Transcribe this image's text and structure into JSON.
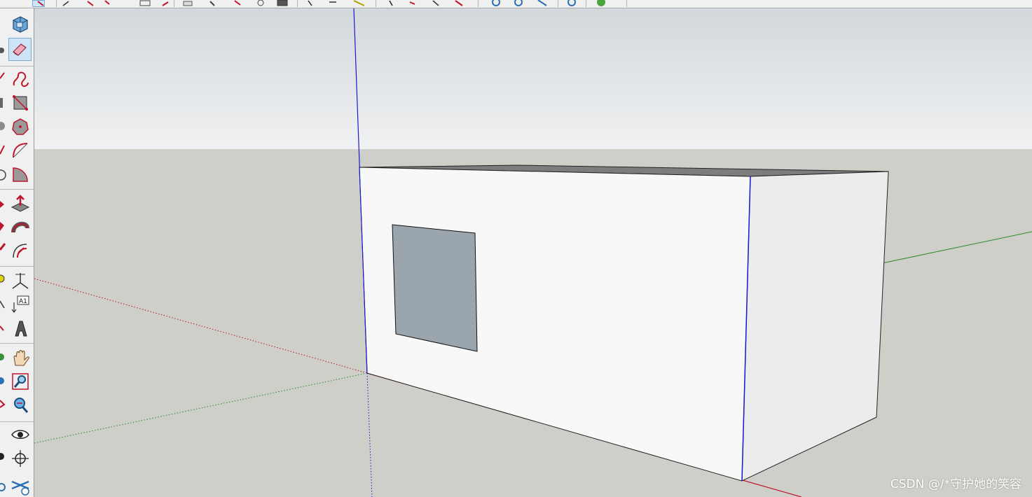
{
  "top_toolbar": {
    "tools": [
      "select-tool",
      "eraser-tool",
      "line-tool",
      "arc-tool",
      "rectangle-tool",
      "circle-tool",
      "polygon-tool",
      "push-pull-tool",
      "move-tool",
      "rotate-tool",
      "scale-tool",
      "offset-tool",
      "tape-measure-tool",
      "dimension-tool",
      "protractor-tool",
      "text-tool",
      "orbit-tool",
      "pan-tool",
      "zoom-tool",
      "zoom-extents-tool",
      "warehouse-tool",
      "extension-tool"
    ]
  },
  "left_toolbar": {
    "tools": [
      {
        "name": "components-tool",
        "icon": "components-icon"
      },
      {
        "name": "eraser-tool",
        "icon": "eraser-icon",
        "active": true
      },
      {
        "name": "freehand-tool",
        "icon": "freehand-icon"
      },
      {
        "name": "rotated-rectangle-tool",
        "icon": "rotated-rectangle-icon"
      },
      {
        "name": "polygon-tool",
        "icon": "polygon-icon"
      },
      {
        "name": "two-point-arc-tool",
        "icon": "two-point-arc-icon"
      },
      {
        "name": "pie-tool",
        "icon": "pie-icon"
      },
      {
        "name": "push-pull-tool",
        "icon": "push-pull-icon"
      },
      {
        "name": "follow-me-tool",
        "icon": "follow-me-icon"
      },
      {
        "name": "offset-tool",
        "icon": "offset-icon"
      },
      {
        "name": "axes-tool",
        "icon": "axes-icon"
      },
      {
        "name": "text-tool",
        "icon": "text-label-icon",
        "label": "A1"
      },
      {
        "name": "3d-text-tool",
        "icon": "3d-text-icon"
      },
      {
        "name": "pan-tool",
        "icon": "hand-icon"
      },
      {
        "name": "zoom-window-tool",
        "icon": "zoom-window-icon"
      },
      {
        "name": "zoom-extents-tool",
        "icon": "zoom-extents-icon"
      },
      {
        "name": "look-around-tool",
        "icon": "eye-icon"
      },
      {
        "name": "position-camera-tool",
        "icon": "crosshair-icon"
      },
      {
        "name": "section-plane-tool",
        "icon": "section-plane-icon"
      }
    ]
  },
  "viewport": {
    "sky_color": "#e4e7ea",
    "ground_color": "#cfcfca",
    "model": {
      "front_face_color": "#f8f8f8",
      "side_face_color": "#ececec",
      "top_face_color": "#7d7d7d",
      "window_color": "#9aa5ae"
    }
  },
  "watermark": "CSDN @/*守护她的笑容"
}
